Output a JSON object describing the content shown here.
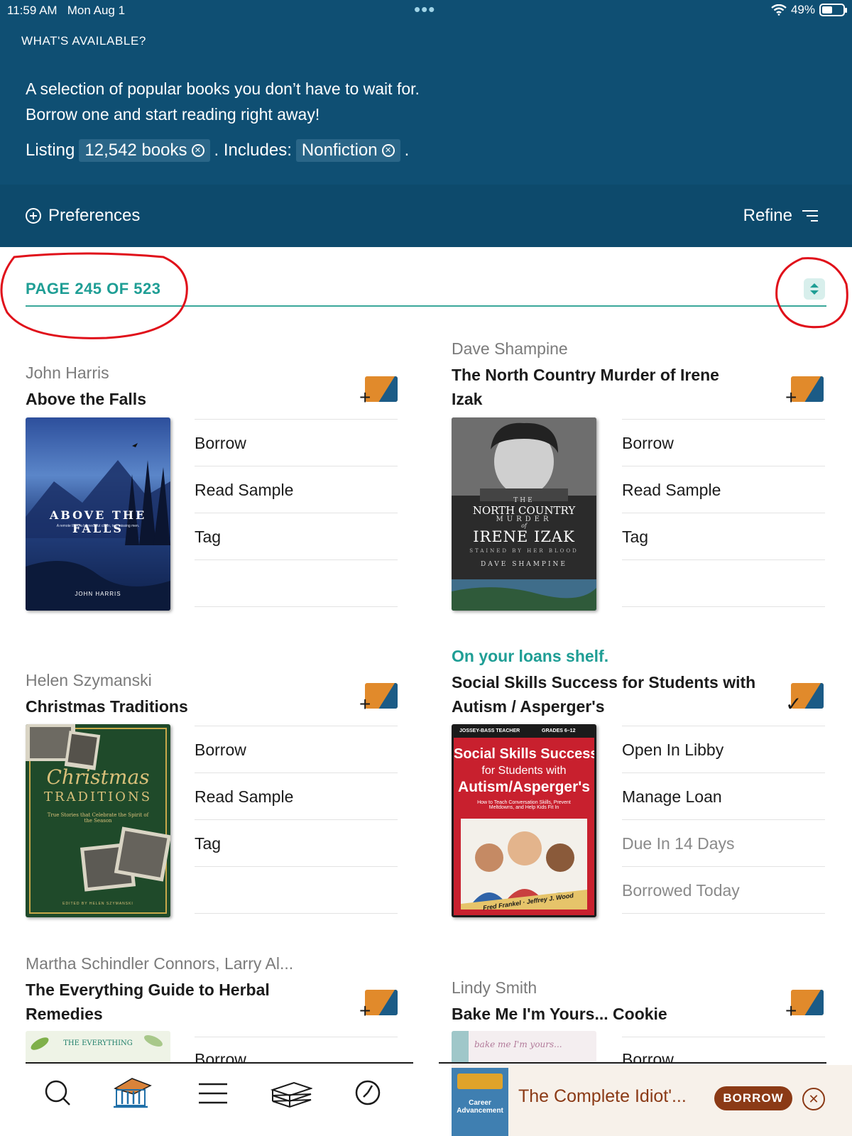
{
  "status_bar": {
    "time": "11:59 AM",
    "date": "Mon Aug 1",
    "battery": "49%"
  },
  "header": {
    "section_title": "WHAT'S AVAILABLE?",
    "description_line1": "A selection of popular books you don’t have to wait for.",
    "description_line2": "Borrow one and start reading right away!",
    "listing_prefix": "Listing",
    "listing_count": "12,542 books",
    "includes_label": ". Includes:",
    "includes_filter": "Nonfiction",
    "includes_suffix": ".",
    "preferences_label": "Preferences",
    "refine_label": "Refine"
  },
  "pagination": {
    "label": "PAGE 245 OF 523"
  },
  "books": [
    {
      "author": "John Harris",
      "title": "Above the Falls",
      "status": "",
      "cover_title": "ABOVE THE FALLS",
      "cover_subtitle": "A remote lake, a burned-out cabin, two missing men.",
      "cover_author": "JOHN HARRIS",
      "actions": [
        "Borrow",
        "Read Sample",
        "Tag"
      ]
    },
    {
      "author": "Dave Shampine",
      "title": "The North Country Murder of Irene Izak",
      "status": "",
      "cover_title_top": "THE",
      "cover_title_1": "NORTH COUNTRY",
      "cover_title_2": "MURDER",
      "cover_title_3": "of",
      "cover_title_4": "IRENE IZAK",
      "cover_subtitle": "STAINED BY HER BLOOD",
      "cover_author": "DAVE SHAMPINE",
      "actions": [
        "Borrow",
        "Read Sample",
        "Tag"
      ]
    },
    {
      "author": "Helen Szymanski",
      "title": "Christmas Traditions",
      "status": "",
      "cover_title_1": "Christmas",
      "cover_title_2": "TRADITIONS",
      "cover_subtitle": "True Stories that Celebrate the Spirit of the Season",
      "cover_author": "EDITED BY HELEN SZYMANSKI",
      "actions": [
        "Borrow",
        "Read Sample",
        "Tag"
      ]
    },
    {
      "author": "",
      "title": "Social Skills Success for Students with Autism / Asperger's",
      "status": "On your loans shelf.",
      "cover_publisher": "JOSSEY-BASS TEACHER",
      "cover_grades": "GRADES 6–12",
      "cover_title_1": "Social Skills Success",
      "cover_title_2": "for Students with",
      "cover_title_3": "Autism/Asperger's",
      "cover_subtitle": "How to Teach Conversation Skills, Prevent Meltdowns, and Help Kids Fit In",
      "cover_author": "Fred Frankel · Jeffrey J. Wood",
      "actions": [
        "Open In Libby",
        "Manage Loan",
        "Due In 14 Days",
        "Borrowed Today"
      ]
    },
    {
      "author": "Martha Schindler Connors, Larry Al...",
      "title": "The Everything Guide to Herbal Remedies",
      "status": "",
      "cover_title": "THE EVERYTHING",
      "actions": [
        "Borrow"
      ]
    },
    {
      "author": "Lindy Smith",
      "title": "Bake Me I'm Yours... Cookie",
      "status": "",
      "cover_title": "bake me I'm yours...",
      "actions": [
        "Borrow"
      ]
    }
  ],
  "now_playing": {
    "title": "The Complete Idiot'...",
    "cover_text": "Career Advancement",
    "borrow_label": "BORROW"
  },
  "colors": {
    "header_bg": "#0f4f73",
    "accent_teal": "#1f9e95",
    "tag_orange": "#e18a2b",
    "tag_blue": "#1b5b86",
    "borrow_brown": "#8b3a16",
    "annotation_red": "#e0101a"
  }
}
